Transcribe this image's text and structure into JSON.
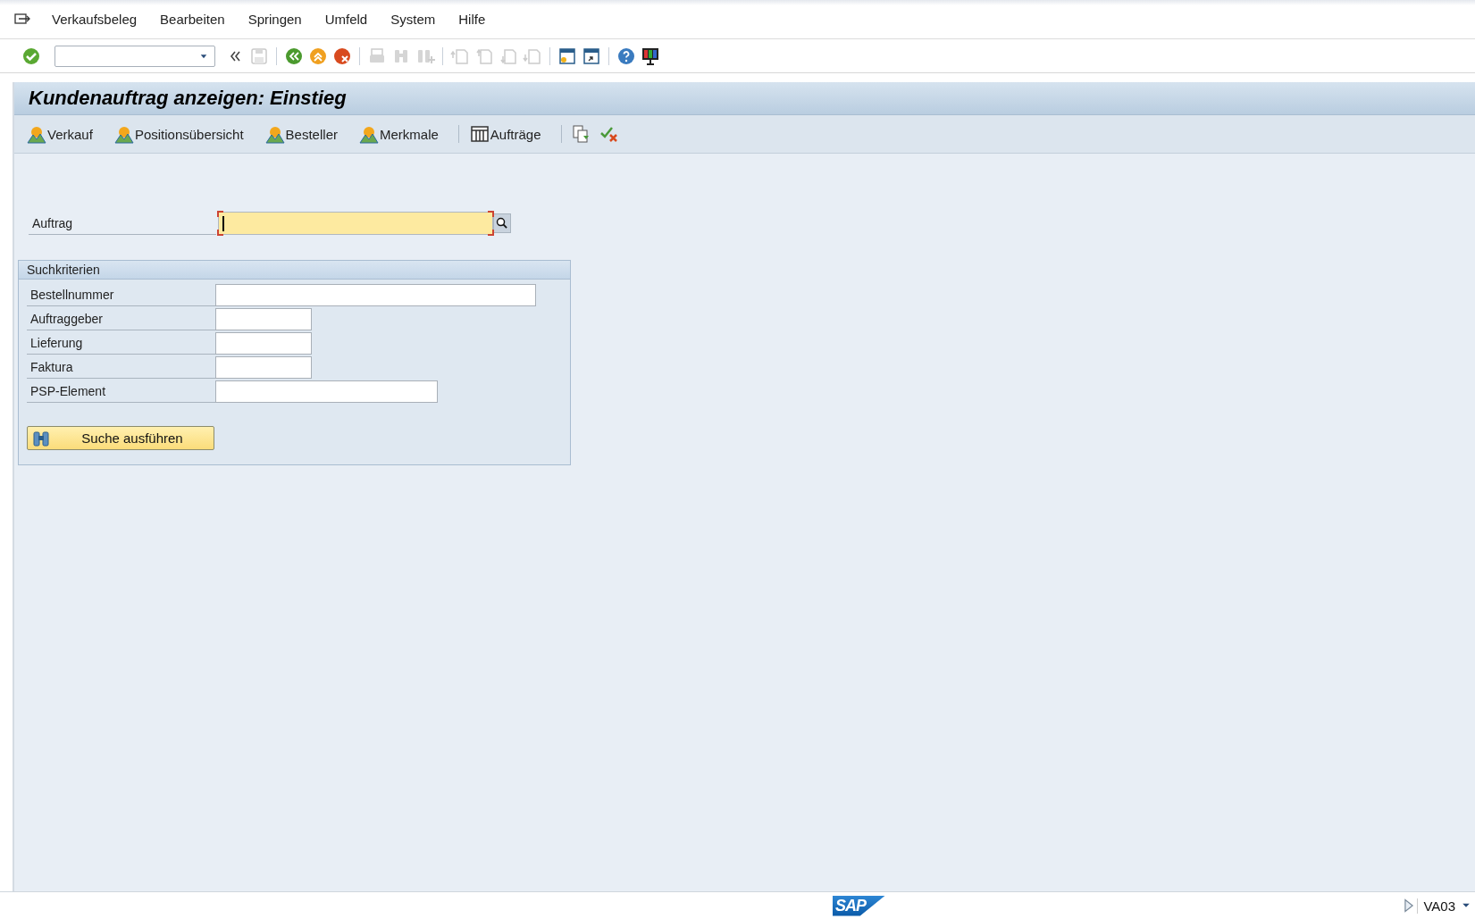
{
  "menu_bar": {
    "items": [
      {
        "label": "Verkaufsbeleg"
      },
      {
        "label": "Bearbeiten"
      },
      {
        "label": "Springen"
      },
      {
        "label": "Umfeld"
      },
      {
        "label": "System"
      },
      {
        "label": "Hilfe"
      }
    ]
  },
  "toolbar": {
    "buttons": [
      {
        "kind": "enter",
        "disabled": false
      },
      {
        "kind": "command-field"
      },
      {
        "kind": "collapse",
        "disabled": false
      },
      {
        "kind": "save",
        "disabled": true
      },
      {
        "kind": "sep"
      },
      {
        "kind": "back",
        "disabled": false
      },
      {
        "kind": "exit",
        "disabled": false
      },
      {
        "kind": "cancel",
        "disabled": false
      },
      {
        "kind": "sep"
      },
      {
        "kind": "print",
        "disabled": true
      },
      {
        "kind": "find",
        "disabled": true
      },
      {
        "kind": "find-next",
        "disabled": true
      },
      {
        "kind": "sep"
      },
      {
        "kind": "first-page",
        "disabled": true
      },
      {
        "kind": "prev-page",
        "disabled": true
      },
      {
        "kind": "next-page",
        "disabled": true
      },
      {
        "kind": "last-page",
        "disabled": true
      },
      {
        "kind": "sep"
      },
      {
        "kind": "new-session",
        "disabled": false
      },
      {
        "kind": "shortcut",
        "disabled": false
      },
      {
        "kind": "sep"
      },
      {
        "kind": "help",
        "disabled": false
      },
      {
        "kind": "layout",
        "disabled": false
      }
    ]
  },
  "title": "Kundenauftrag anzeigen: Einstieg",
  "app_toolbar": {
    "items": [
      {
        "kind": "scenario",
        "label": "Verkauf"
      },
      {
        "kind": "scenario",
        "label": "Positionsübersicht"
      },
      {
        "kind": "scenario",
        "label": "Besteller"
      },
      {
        "kind": "scenario",
        "label": "Merkmale"
      },
      {
        "kind": "sep"
      },
      {
        "kind": "list",
        "label": "Aufträge"
      },
      {
        "kind": "sep"
      },
      {
        "kind": "copy-icon"
      },
      {
        "kind": "check-icon"
      }
    ]
  },
  "entry": {
    "label": "Auftrag",
    "required": true,
    "focused": true
  },
  "search_group": {
    "title": "Suchkriterien",
    "fields": [
      {
        "label": "Bestellnummer"
      },
      {
        "label": "Auftraggeber"
      },
      {
        "label": "Lieferung"
      },
      {
        "label": "Faktura"
      },
      {
        "label": "PSP-Element"
      }
    ],
    "button": "Suche ausführen"
  },
  "status_bar": {
    "logo": "SAP",
    "transaction": "VA03"
  }
}
